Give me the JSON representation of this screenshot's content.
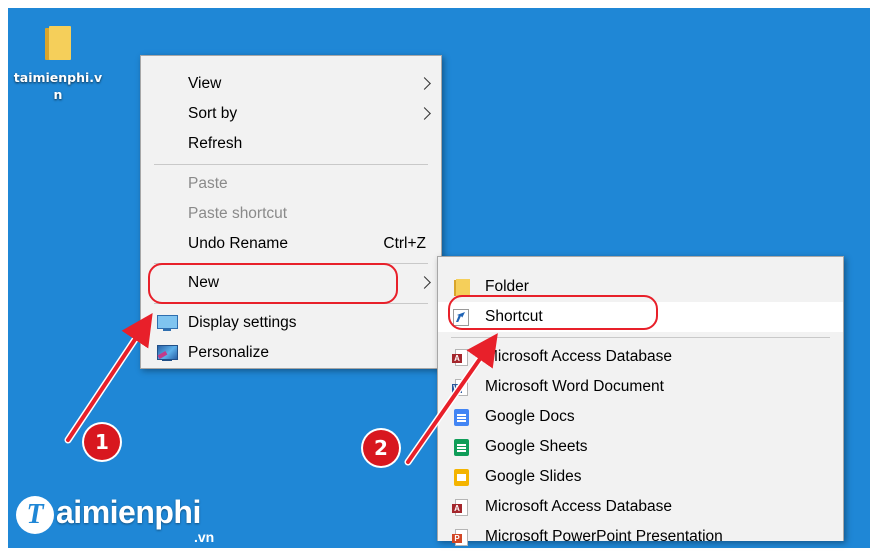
{
  "desktop": {
    "icon_label": "taimienphi.vn"
  },
  "context_menu": {
    "items": [
      {
        "label": "View",
        "submenu": true
      },
      {
        "label": "Sort by",
        "submenu": true
      },
      {
        "label": "Refresh"
      },
      {
        "label": "Paste",
        "disabled": true
      },
      {
        "label": "Paste shortcut",
        "disabled": true
      },
      {
        "label": "Undo Rename",
        "shortcut": "Ctrl+Z"
      },
      {
        "label": "New",
        "submenu": true
      },
      {
        "label": "Display settings",
        "icon": "display-settings-icon"
      },
      {
        "label": "Personalize",
        "icon": "personalize-icon"
      }
    ]
  },
  "new_submenu": {
    "items": [
      {
        "label": "Folder",
        "icon": "folder-icon"
      },
      {
        "label": "Shortcut",
        "icon": "shortcut-icon"
      },
      {
        "label": "Microsoft Access Database",
        "icon": "access-icon"
      },
      {
        "label": "Microsoft Word Document",
        "icon": "word-icon"
      },
      {
        "label": "Google Docs",
        "icon": "google-docs-icon"
      },
      {
        "label": "Google Sheets",
        "icon": "google-sheets-icon"
      },
      {
        "label": "Google Slides",
        "icon": "google-slides-icon"
      },
      {
        "label": "Microsoft Access Database",
        "icon": "access-icon"
      },
      {
        "label": "Microsoft PowerPoint Presentation",
        "icon": "powerpoint-icon"
      }
    ]
  },
  "annotations": {
    "step1": "1",
    "step2": "2",
    "highlight_color": "#e8202a"
  },
  "watermark": {
    "logo_letter": "T",
    "brand": "aimienphi",
    "tld": ".vn"
  },
  "colors": {
    "desktop_bg": "#1f87d6",
    "menu_bg": "#f2f2f2"
  }
}
